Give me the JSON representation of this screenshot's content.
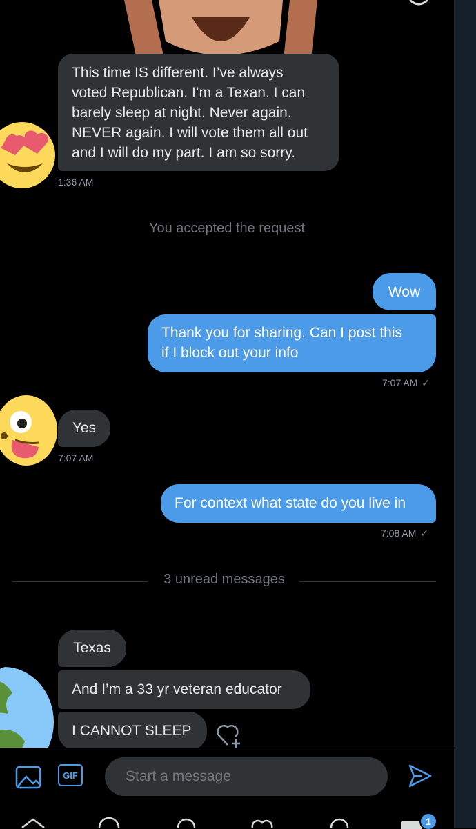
{
  "messages": {
    "first_incoming": "This time IS different.  I’ve always\nvoted Republican.  I’m a Texan. I can\nbarely sleep at night. Never again.\nNEVER again.  I will vote them all out\nand I will do my part. I am so sorry.",
    "first_time": "1:36 AM",
    "accepted_note": "You accepted the request",
    "out_wow": "Wow",
    "out_thanks": "Thank you for sharing. Can I post this\nif I block out your info",
    "out_thanks_time": "7:07 AM",
    "in_yes": "Yes",
    "in_yes_time": "7:07 AM",
    "out_context": "For context what state do you live in",
    "out_context_time": "7:08 AM",
    "unread_divider": "3 unread messages",
    "in_texas": "Texas",
    "in_educator": "And I’m a 33 yr veteran educator",
    "in_cannot_sleep": "I CANNOT SLEEP"
  },
  "composer": {
    "gif_label": "GIF",
    "placeholder": "Start a message"
  },
  "nav": {
    "notification_count": "1"
  },
  "colors": {
    "accent": "#4c9be8",
    "incoming_bubble": "#2f3336",
    "background": "#000000"
  },
  "icons": {
    "read_receipt": "check-icon",
    "react": "heart-plus-icon",
    "image": "image-icon",
    "send": "send-icon"
  }
}
